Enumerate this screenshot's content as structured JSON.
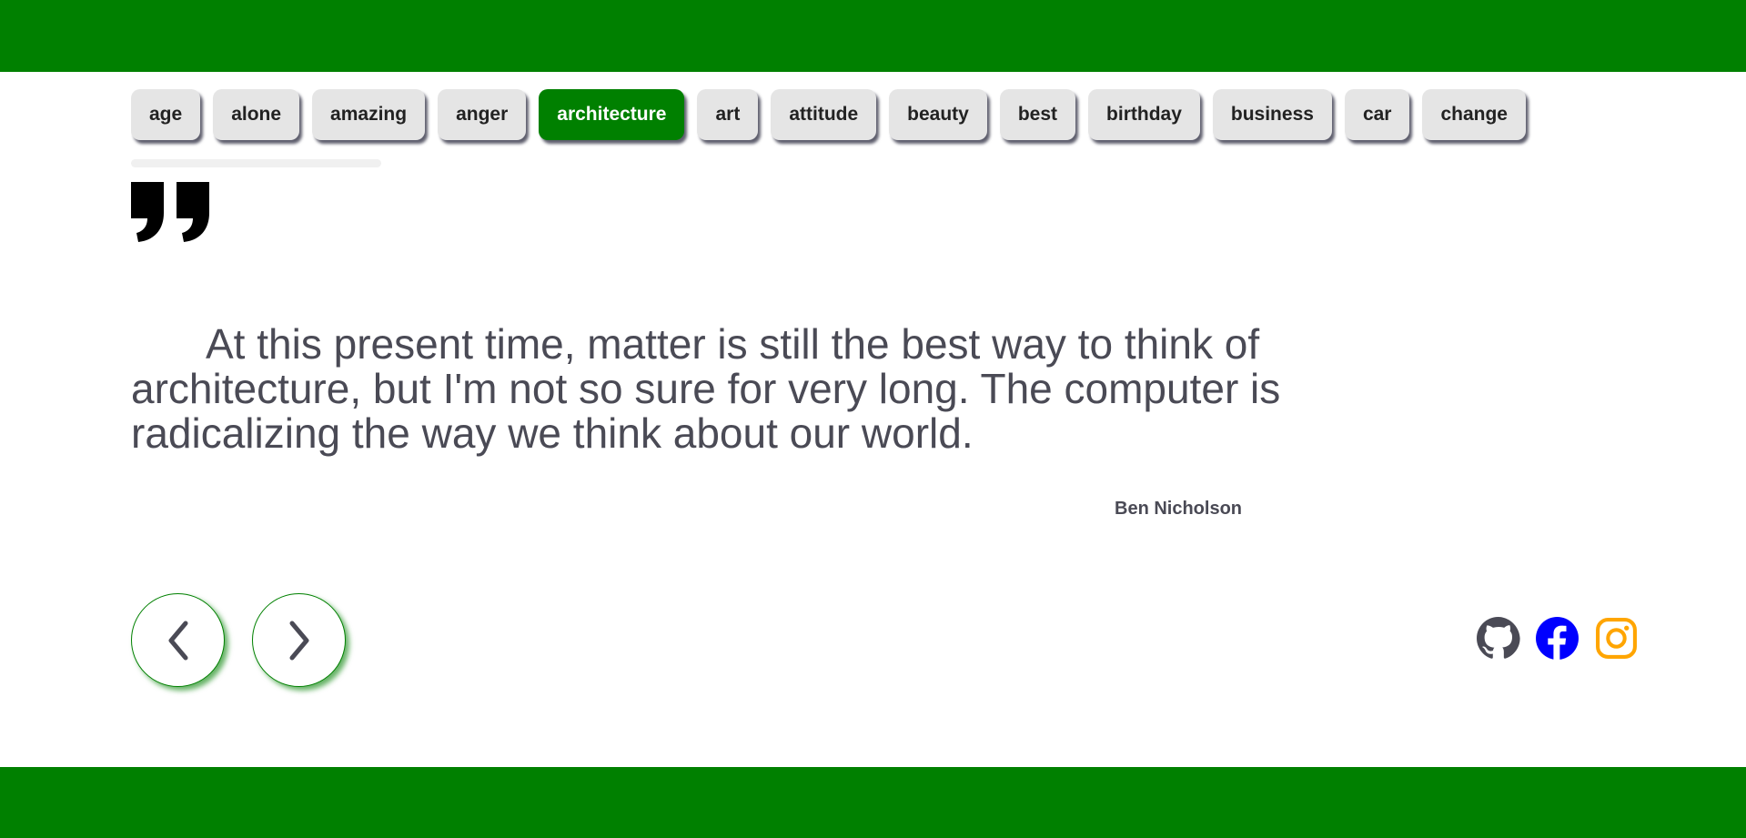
{
  "categories": {
    "items": [
      "age",
      "alone",
      "amazing",
      "anger",
      "architecture",
      "art",
      "attitude",
      "beauty",
      "best",
      "birthday",
      "business",
      "car",
      "change"
    ],
    "active": "architecture"
  },
  "quote": {
    "text": "At this present time, matter is still the best way to think of architecture, but I'm not so sure for very long. The computer is radicalizing the way we think about our world.",
    "author": "Ben Nicholson"
  },
  "colors": {
    "brand": "#008000",
    "github": "#4a4a55",
    "facebook": "#0000ff",
    "instagram": "#ffa500"
  },
  "social": [
    "github-icon",
    "facebook-icon",
    "instagram-icon"
  ]
}
